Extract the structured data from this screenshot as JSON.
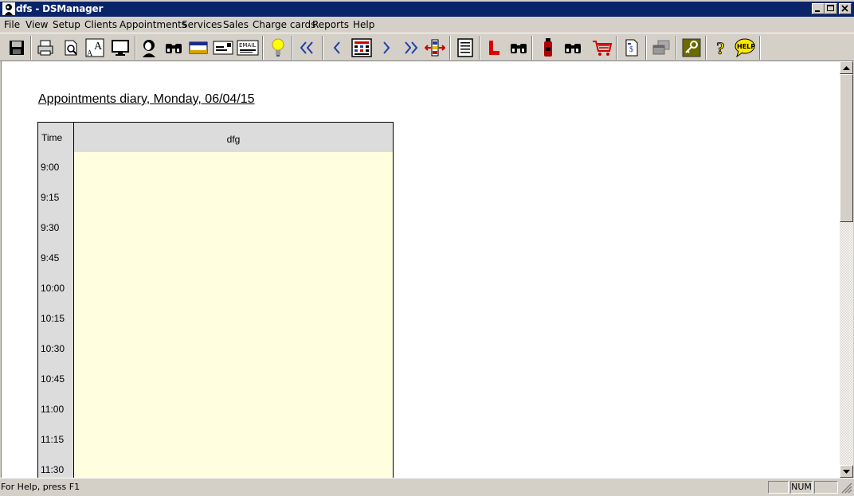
{
  "window": {
    "title": "dfs - DSManager"
  },
  "menu": [
    "File",
    "View",
    "Setup",
    "Clients",
    "Appointments",
    "Services",
    "Sales",
    "Charge cards",
    "Reports",
    "Help"
  ],
  "toolbar": {
    "icons": [
      "save-icon",
      "print-icon",
      "print-preview-icon",
      "font-icon",
      "monitor-icon",
      "client-icon",
      "find-client-icon",
      "credit-card-icon",
      "message-icon",
      "email-icon",
      "tip-icon",
      "first-icon",
      "previous-icon",
      "calendar-icon",
      "next-icon",
      "last-icon",
      "column-icon",
      "report-icon",
      "l-icon",
      "find-icon",
      "product-icon",
      "find-product-icon",
      "cart-icon",
      "charge-card-icon",
      "windows-icon",
      "key-icon",
      "help-question-icon",
      "help-bubble-icon"
    ],
    "email_text": "EMAIL",
    "help_text": "HELP"
  },
  "diary": {
    "title": "Appointments diary, Monday, 06/04/15",
    "time_header": "Time",
    "column_header": "dfg",
    "times": [
      "9:00",
      "9:15",
      "9:30",
      "9:45",
      "10:00",
      "10:15",
      "10:30",
      "10:45",
      "11:00",
      "11:15",
      "11:30"
    ]
  },
  "status": {
    "message": "For Help, press F1",
    "num": "NUM"
  },
  "colors": {
    "titlebar": "#0a246a",
    "slot": "#ffffe0",
    "timecell": "#dcdcdc"
  }
}
